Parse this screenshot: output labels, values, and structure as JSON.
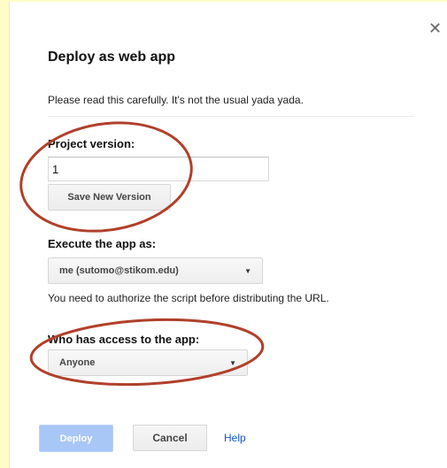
{
  "dialog": {
    "title": "Deploy as web app",
    "close_icon": "close-icon",
    "intro": "Please read this carefully. It's not the usual yada yada."
  },
  "project_version": {
    "label": "Project version:",
    "value": "1",
    "save_button": "Save New Version"
  },
  "execute_as": {
    "label": "Execute the app as:",
    "selected": "me (sutomo@stikom.edu)",
    "note": "You need to authorize the script before distributing the URL."
  },
  "access": {
    "label": "Who has access to the app:",
    "selected": "Anyone"
  },
  "footer": {
    "deploy": "Deploy",
    "cancel": "Cancel",
    "help": "Help"
  },
  "colors": {
    "page_bg": "#fdfcc6",
    "annotation": "#b0402a",
    "primary_disabled": "#a8c6f6",
    "link": "#1155cc"
  }
}
